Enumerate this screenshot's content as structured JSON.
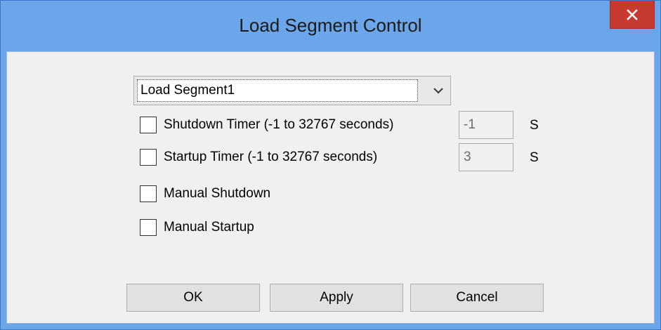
{
  "window": {
    "title": "Load Segment Control",
    "close_icon": "close-icon"
  },
  "segment_select": {
    "value": "Load Segment1"
  },
  "options": [
    {
      "label": "Shutdown Timer (-1 to 32767 seconds)",
      "checked": false,
      "value": "-1",
      "unit": "S"
    },
    {
      "label": "Startup Timer (-1 to 32767 seconds)",
      "checked": false,
      "value": "3",
      "unit": "S"
    },
    {
      "label": "Manual Shutdown",
      "checked": false
    },
    {
      "label": "Manual Startup",
      "checked": false
    }
  ],
  "buttons": {
    "ok": "OK",
    "apply": "Apply",
    "cancel": "Cancel"
  },
  "colors": {
    "title_bar": "#6aa6e9",
    "close_button": "#c73a32",
    "dialog_background": "#f0f0f0"
  }
}
